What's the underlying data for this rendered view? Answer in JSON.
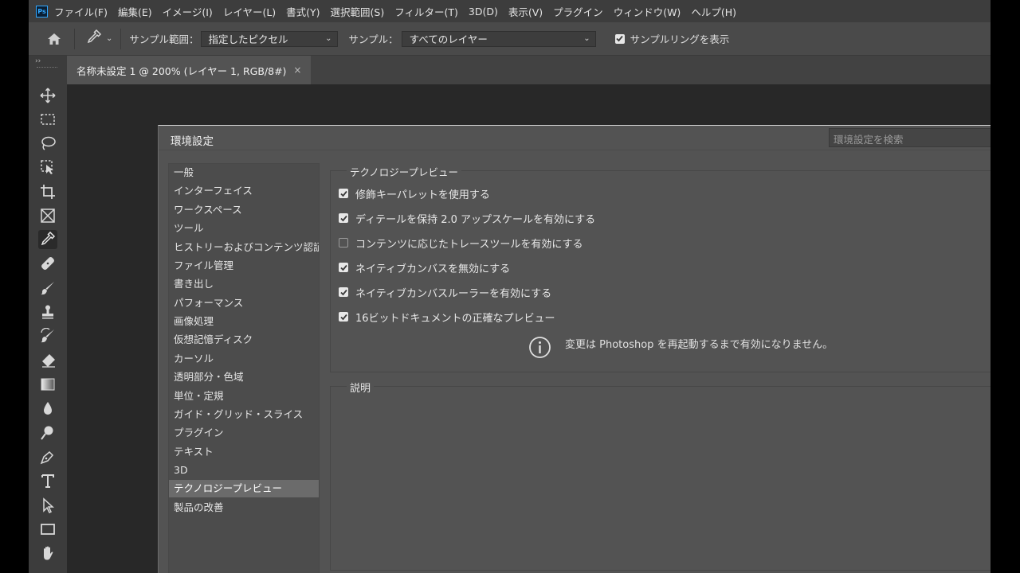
{
  "app": {
    "logo": "Ps",
    "accent": "#31a8ff"
  },
  "menu": [
    "ファイル(F)",
    "編集(E)",
    "イメージ(I)",
    "レイヤー(L)",
    "書式(Y)",
    "選択範囲(S)",
    "フィルター(T)",
    "3D(D)",
    "表示(V)",
    "プラグイン",
    "ウィンドウ(W)",
    "ヘルプ(H)"
  ],
  "options_bar": {
    "sample_size_label": "サンプル範囲：",
    "sample_size_value": "指定したピクセル",
    "sample_label": "サンプル：",
    "sample_value": "すべてのレイヤー",
    "show_ring_label": "サンプルリングを表示",
    "show_ring_checked": true
  },
  "document_tab": {
    "title": "名称未設定 1 @ 200% (レイヤー 1, RGB/8#)",
    "close": "×"
  },
  "toolbar": {
    "collapse": "››",
    "tools": [
      "move-tool",
      "marquee-tool",
      "lasso-tool",
      "object-select-tool",
      "crop-tool",
      "frame-tool",
      "eyedropper-tool",
      "healing-tool",
      "brush-tool",
      "stamp-tool",
      "history-brush-tool",
      "eraser-tool",
      "gradient-tool",
      "blur-tool",
      "dodge-tool",
      "pen-tool",
      "type-tool",
      "path-select-tool",
      "rectangle-tool",
      "hand-tool"
    ],
    "active": "eyedropper-tool"
  },
  "dialog": {
    "title": "環境設定",
    "search_placeholder": "環境設定を検索",
    "categories": [
      "一般",
      "インターフェイス",
      "ワークスペース",
      "ツール",
      "ヒストリーおよびコンテンツ認証...",
      "ファイル管理",
      "書き出し",
      "パフォーマンス",
      "画像処理",
      "仮想記憶ディスク",
      "カーソル",
      "透明部分・色域",
      "単位・定規",
      "ガイド・グリッド・スライス",
      "プラグイン",
      "テキスト",
      "3D",
      "テクノロジープレビュー",
      "製品の改善"
    ],
    "selected_category": "テクノロジープレビュー",
    "tech_preview": {
      "legend": "テクノロジープレビュー",
      "options": [
        {
          "label": "修飾キーパレットを使用する",
          "checked": true
        },
        {
          "label": "ディテールを保持 2.0 アップスケールを有効にする",
          "checked": true
        },
        {
          "label": "コンテンツに応じたトレースツールを有効にする",
          "checked": false
        },
        {
          "label": "ネイティブカンバスを無効にする",
          "checked": true
        },
        {
          "label": "ネイティブカンバスルーラーを有効にする",
          "checked": true
        },
        {
          "label": "16ビットドキュメントの正確なプレビュー",
          "checked": true
        }
      ],
      "notice": "変更は Photoshop を再起動するまで有効になりません。"
    },
    "description_legend": "説明"
  }
}
